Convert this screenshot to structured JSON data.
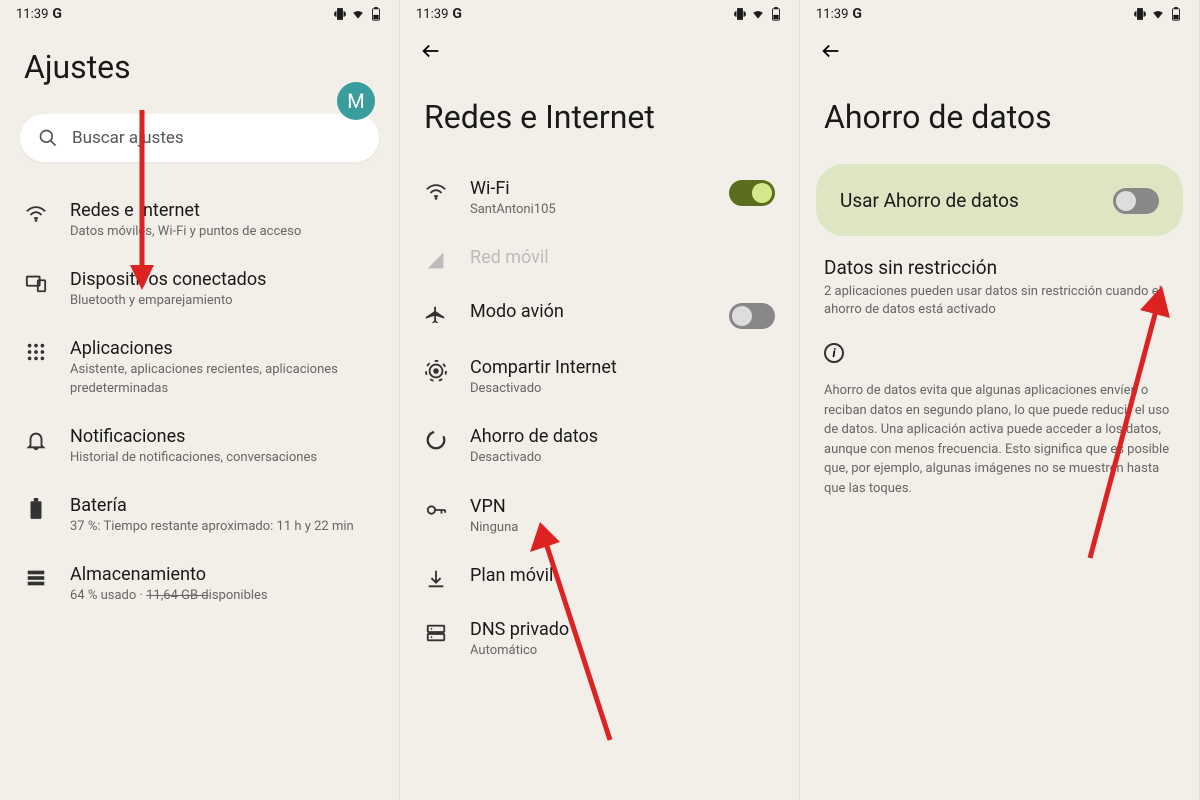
{
  "statusBar": {
    "time": "11:39",
    "gLogo": "G"
  },
  "screen1": {
    "title": "Ajustes",
    "avatar": "M",
    "searchPlaceholder": "Buscar ajustes",
    "items": [
      {
        "title": "Redes e Internet",
        "sub": "Datos móviles, Wi-Fi y puntos de acceso"
      },
      {
        "title": "Dispositivos conectados",
        "sub": "Bluetooth y emparejamiento"
      },
      {
        "title": "Aplicaciones",
        "sub": "Asistente, aplicaciones recientes, aplicaciones predeterminadas"
      },
      {
        "title": "Notificaciones",
        "sub": "Historial de notificaciones, conversaciones"
      },
      {
        "title": "Batería",
        "sub": "37 %: Tiempo restante aproximado: 11 h y 22 min"
      },
      {
        "title": "Almacenamiento",
        "subPrefix": "64 % usado · ",
        "subStrike": "11,64 GB d",
        "subSuffix": "isponibles"
      }
    ]
  },
  "screen2": {
    "title": "Redes e Internet",
    "items": [
      {
        "title": "Wi-Fi",
        "sub": "SantAntoni105",
        "toggle": "on"
      },
      {
        "title": "Red móvil",
        "disabled": true
      },
      {
        "title": "Modo avión",
        "toggle": "off"
      },
      {
        "title": "Compartir Internet",
        "sub": "Desactivado"
      },
      {
        "title": "Ahorro de datos",
        "sub": "Desactivado"
      },
      {
        "title": "VPN",
        "sub": "Ninguna"
      },
      {
        "title": "Plan móvil"
      },
      {
        "title": "DNS privado",
        "sub": "Automático"
      }
    ]
  },
  "screen3": {
    "title": "Ahorro de datos",
    "mainToggleLabel": "Usar Ahorro de datos",
    "unrestricted": {
      "title": "Datos sin restricción",
      "sub": "2 aplicaciones pueden usar datos sin restricción cuando el ahorro de datos está activado"
    },
    "description": "Ahorro de datos evita que algunas aplicaciones envíen o reciban datos en segundo plano, lo que puede reducir el uso de datos. Una aplicación activa puede acceder a los datos, aunque con menos frecuencia. Esto significa que es posible que, por ejemplo, algunas imágenes no se muestren hasta que las toques."
  }
}
